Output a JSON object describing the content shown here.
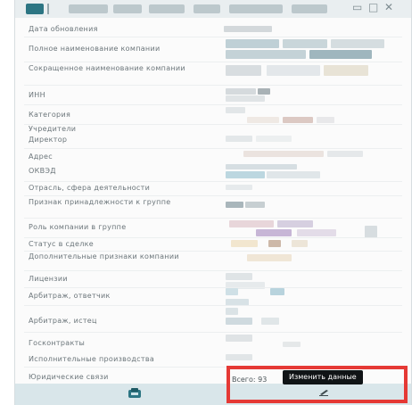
{
  "rows": [
    {
      "label": "Дата обновления"
    },
    {
      "label": "Полное наименование компании"
    },
    {
      "label": "Сокращенное наименование компании"
    },
    {
      "label": "ИНН"
    },
    {
      "label": "Категория"
    },
    {
      "label": "Учредители"
    },
    {
      "label": "Директор"
    },
    {
      "label": "Адрес"
    },
    {
      "label": "ОКВЭД"
    },
    {
      "label": "Отрасль, сфера деятельности"
    },
    {
      "label": "Признак принадлежности к группе"
    },
    {
      "label": "Роль компании в группе"
    },
    {
      "label": "Статус в сделке"
    },
    {
      "label": "Дополнительные признаки компании"
    },
    {
      "label": "Лицензии"
    },
    {
      "label": "Арбитраж, ответчик"
    },
    {
      "label": "Арбитраж, истец"
    },
    {
      "label": "Госконтракты"
    },
    {
      "label": "Исполнительные производства"
    },
    {
      "label": "Юридические связи",
      "value": "Всего: 93"
    }
  ],
  "tooltip": {
    "text": "Изменить данные"
  },
  "icons": {
    "app": "app-icon",
    "window_controls": [
      "restore-icon",
      "maximize-icon",
      "close-icon"
    ],
    "edit": "pencil-icon",
    "footer": "document-icon"
  },
  "colors": {
    "accent": "#2c7583",
    "footer": "#d9e6ea",
    "highlight": "#e53935",
    "tooltip_bg": "#101416"
  }
}
